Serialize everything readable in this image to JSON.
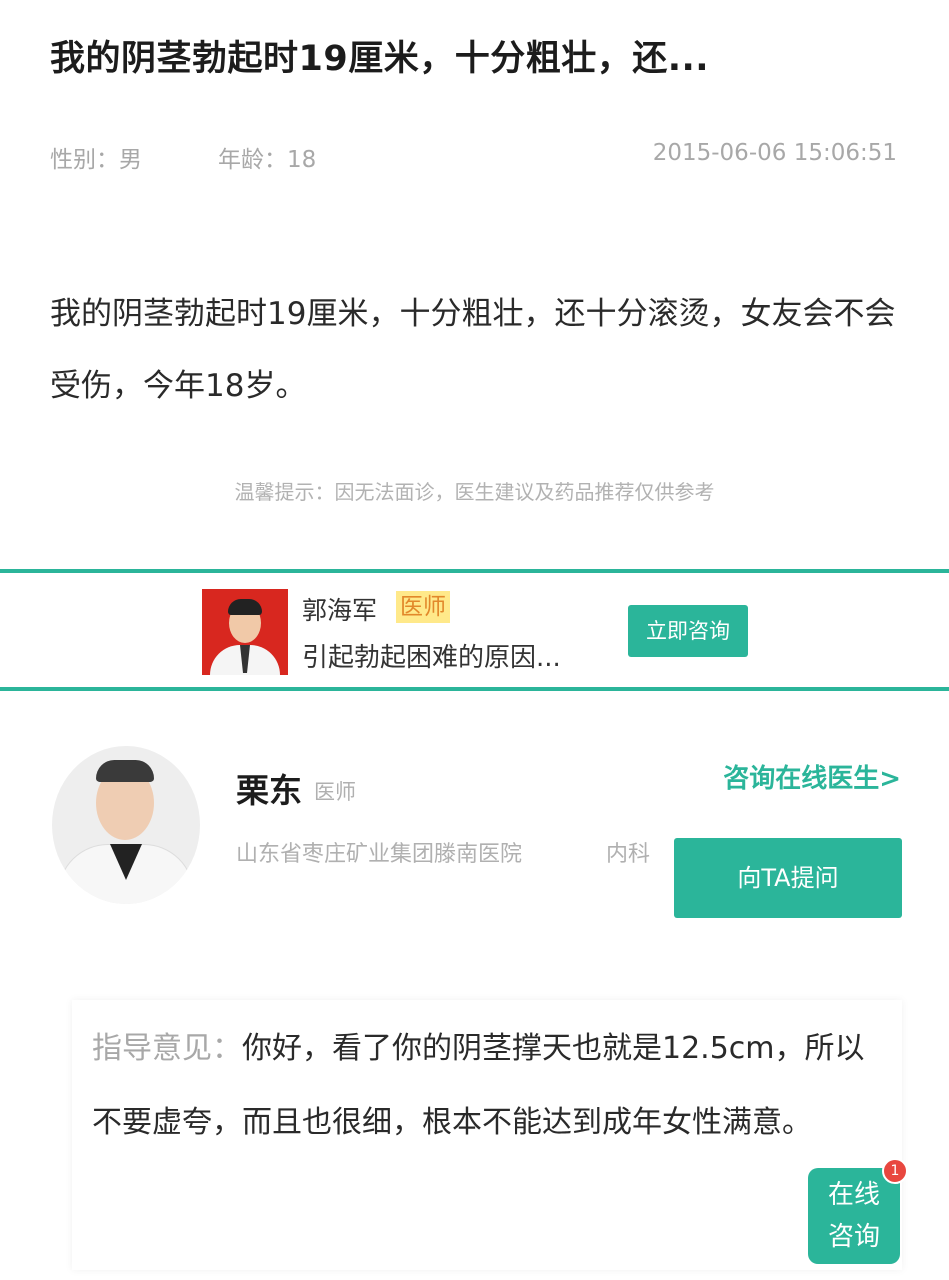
{
  "question": {
    "title": "我的阴茎勃起时19厘米，十分粗壮，还...",
    "gender": "性别：男",
    "age": "年龄：18",
    "time": "2015-06-06 15:06:51",
    "body": "我的阴茎勃起时19厘米，十分粗壮，还十分滚烫，女友会不会受伤，今年18岁。"
  },
  "tip": "温馨提示：因无法面诊，医生建议及药品推荐仅供参考",
  "promo": {
    "doctor_name": "郭海军",
    "badge": "医师",
    "description": "引起勃起困难的原因...",
    "button": "立即咨询"
  },
  "doctor": {
    "name": "栗东",
    "title": "医师",
    "hospital": "山东省枣庄矿业集团滕南医院",
    "department": "内科",
    "consult_link": "咨询在线医生>",
    "ask_button": "向TA提问"
  },
  "advice": {
    "label": "指导意见：",
    "text": "你好，看了你的阴茎撑天也就是12.5cm，所以不要虚夸，而且也很细，根本不能达到成年女性满意。"
  },
  "float_button": {
    "line1": "在线",
    "line2": "咨询",
    "badge_count": "1"
  },
  "colors": {
    "accent": "#2bb59a",
    "badge_bg": "#ffe98a",
    "badge_text": "#e2882a",
    "notification": "#e8473f"
  }
}
